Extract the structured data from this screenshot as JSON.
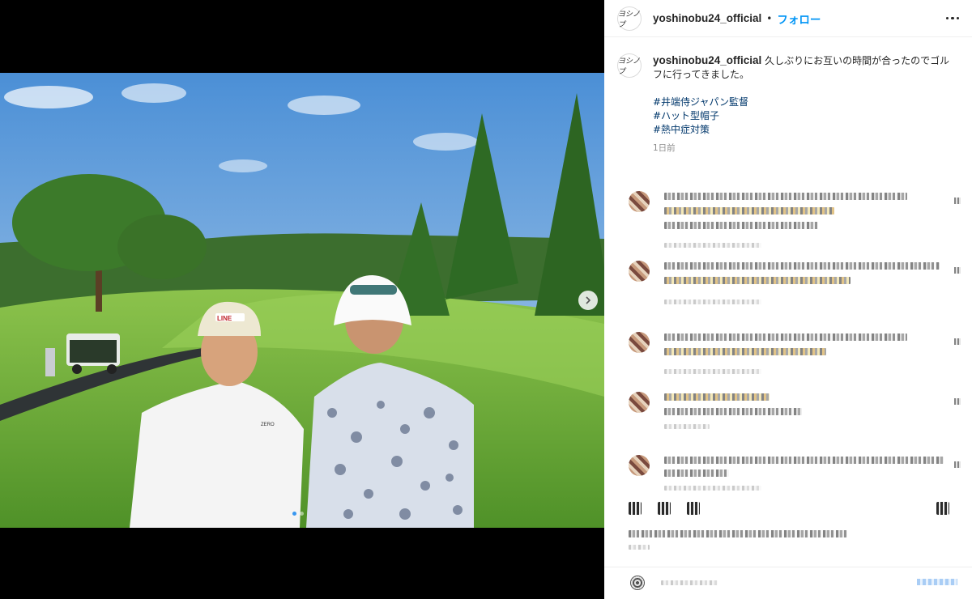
{
  "post": {
    "username": "yoshinobu24_official",
    "separator": "•",
    "follow_label": "フォロー",
    "avatar_text": "ヨシノブ"
  },
  "caption": {
    "username": "yoshinobu24_official",
    "text": "久しぶりにお互いの時間が合ったのでゴルフに行ってきました。",
    "hashtags": [
      "#井端侍ジャパン監督",
      "#ハット型帽子",
      "#熱中症対策"
    ],
    "time": "1日前"
  },
  "photo": {
    "cap_logo": "LINE",
    "shirt_logo": "ZERO",
    "carousel": {
      "count": 2,
      "active_index": 0
    }
  },
  "colors": {
    "link": "#0095f6",
    "hashtag": "#00376b",
    "sky": "#5a98d8",
    "grass": "#5ea233"
  },
  "icons": [
    "more-options-icon",
    "next-arrow-icon",
    "like-icon",
    "comment-icon",
    "share-icon",
    "save-icon",
    "emoji-icon"
  ]
}
